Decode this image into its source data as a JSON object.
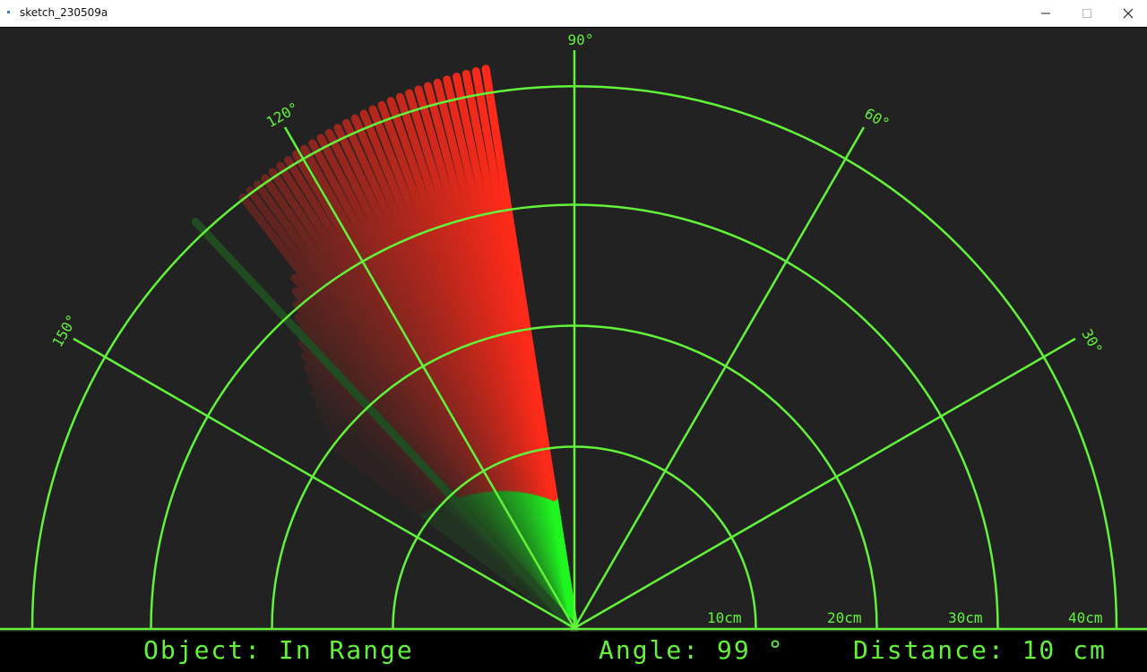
{
  "window": {
    "title": "sketch_230509a",
    "icons": {
      "app": "app-icon",
      "minimize": "minimize-icon",
      "maximize": "maximize-icon",
      "close": "close-icon"
    }
  },
  "radar": {
    "colors": {
      "grid": "#62f43a",
      "sweep": "#1ff51f",
      "object": "#ff2a1a",
      "background": "#222222",
      "status_bar": "#000000"
    },
    "angle_labels": [
      "30°",
      "60°",
      "90°",
      "120°",
      "150°"
    ],
    "distance_labels": [
      "10cm",
      "20cm",
      "30cm",
      "40cm"
    ]
  },
  "status": {
    "object_text": "Object: In Range",
    "angle_text": "Angle: 99 °",
    "distance_text": "Distance: 10 cm"
  }
}
